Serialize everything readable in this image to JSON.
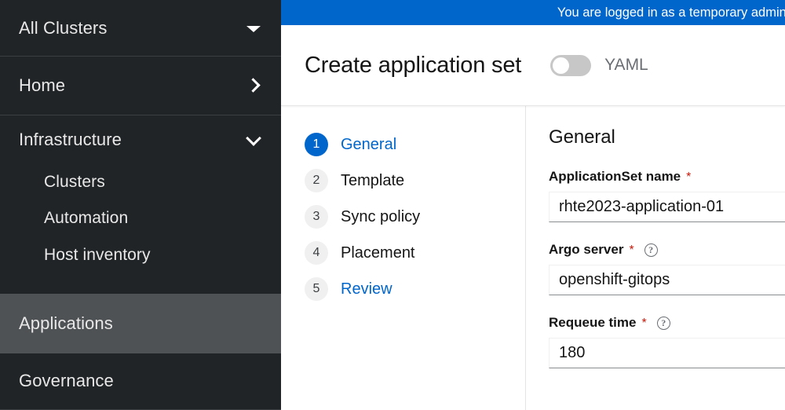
{
  "sidebar": {
    "cluster_selector": {
      "label": "All Clusters",
      "icon": "caret-down-icon"
    },
    "items": [
      {
        "label": "Home",
        "icon": "chevron-right-icon"
      },
      {
        "label": "Infrastructure",
        "icon": "chevron-down-icon"
      }
    ],
    "infrastructure_children": [
      {
        "label": "Clusters"
      },
      {
        "label": "Automation"
      },
      {
        "label": "Host inventory"
      }
    ],
    "applications": {
      "label": "Applications",
      "selected": true
    },
    "governance": {
      "label": "Governance"
    },
    "colors": {
      "background": "#212427",
      "selected": "#4F5255",
      "divider": "#3C3F42"
    }
  },
  "banner": {
    "text": "You are logged in as a temporary administra",
    "color": "#0066CC"
  },
  "header": {
    "title": "Create application set",
    "yaml_toggle": {
      "label": "YAML",
      "enabled": false
    }
  },
  "wizard": {
    "steps": [
      {
        "number": "1",
        "label": "General",
        "state": "active"
      },
      {
        "number": "2",
        "label": "Template",
        "state": "default"
      },
      {
        "number": "3",
        "label": "Sync policy",
        "state": "default"
      },
      {
        "number": "4",
        "label": "Placement",
        "state": "default"
      },
      {
        "number": "5",
        "label": "Review",
        "state": "link"
      }
    ],
    "active_color": "#0066CC"
  },
  "form": {
    "title": "General",
    "required_marker": "*",
    "help_glyph": "?",
    "fields": [
      {
        "label": "ApplicationSet name",
        "required": true,
        "has_help": false,
        "value": "rhte2023-application-01",
        "placeholder": ""
      },
      {
        "label": "Argo server",
        "required": true,
        "has_help": true,
        "value": "openshift-gitops",
        "placeholder": ""
      },
      {
        "label": "Requeue time",
        "required": true,
        "has_help": true,
        "value": "180",
        "placeholder": ""
      }
    ]
  }
}
